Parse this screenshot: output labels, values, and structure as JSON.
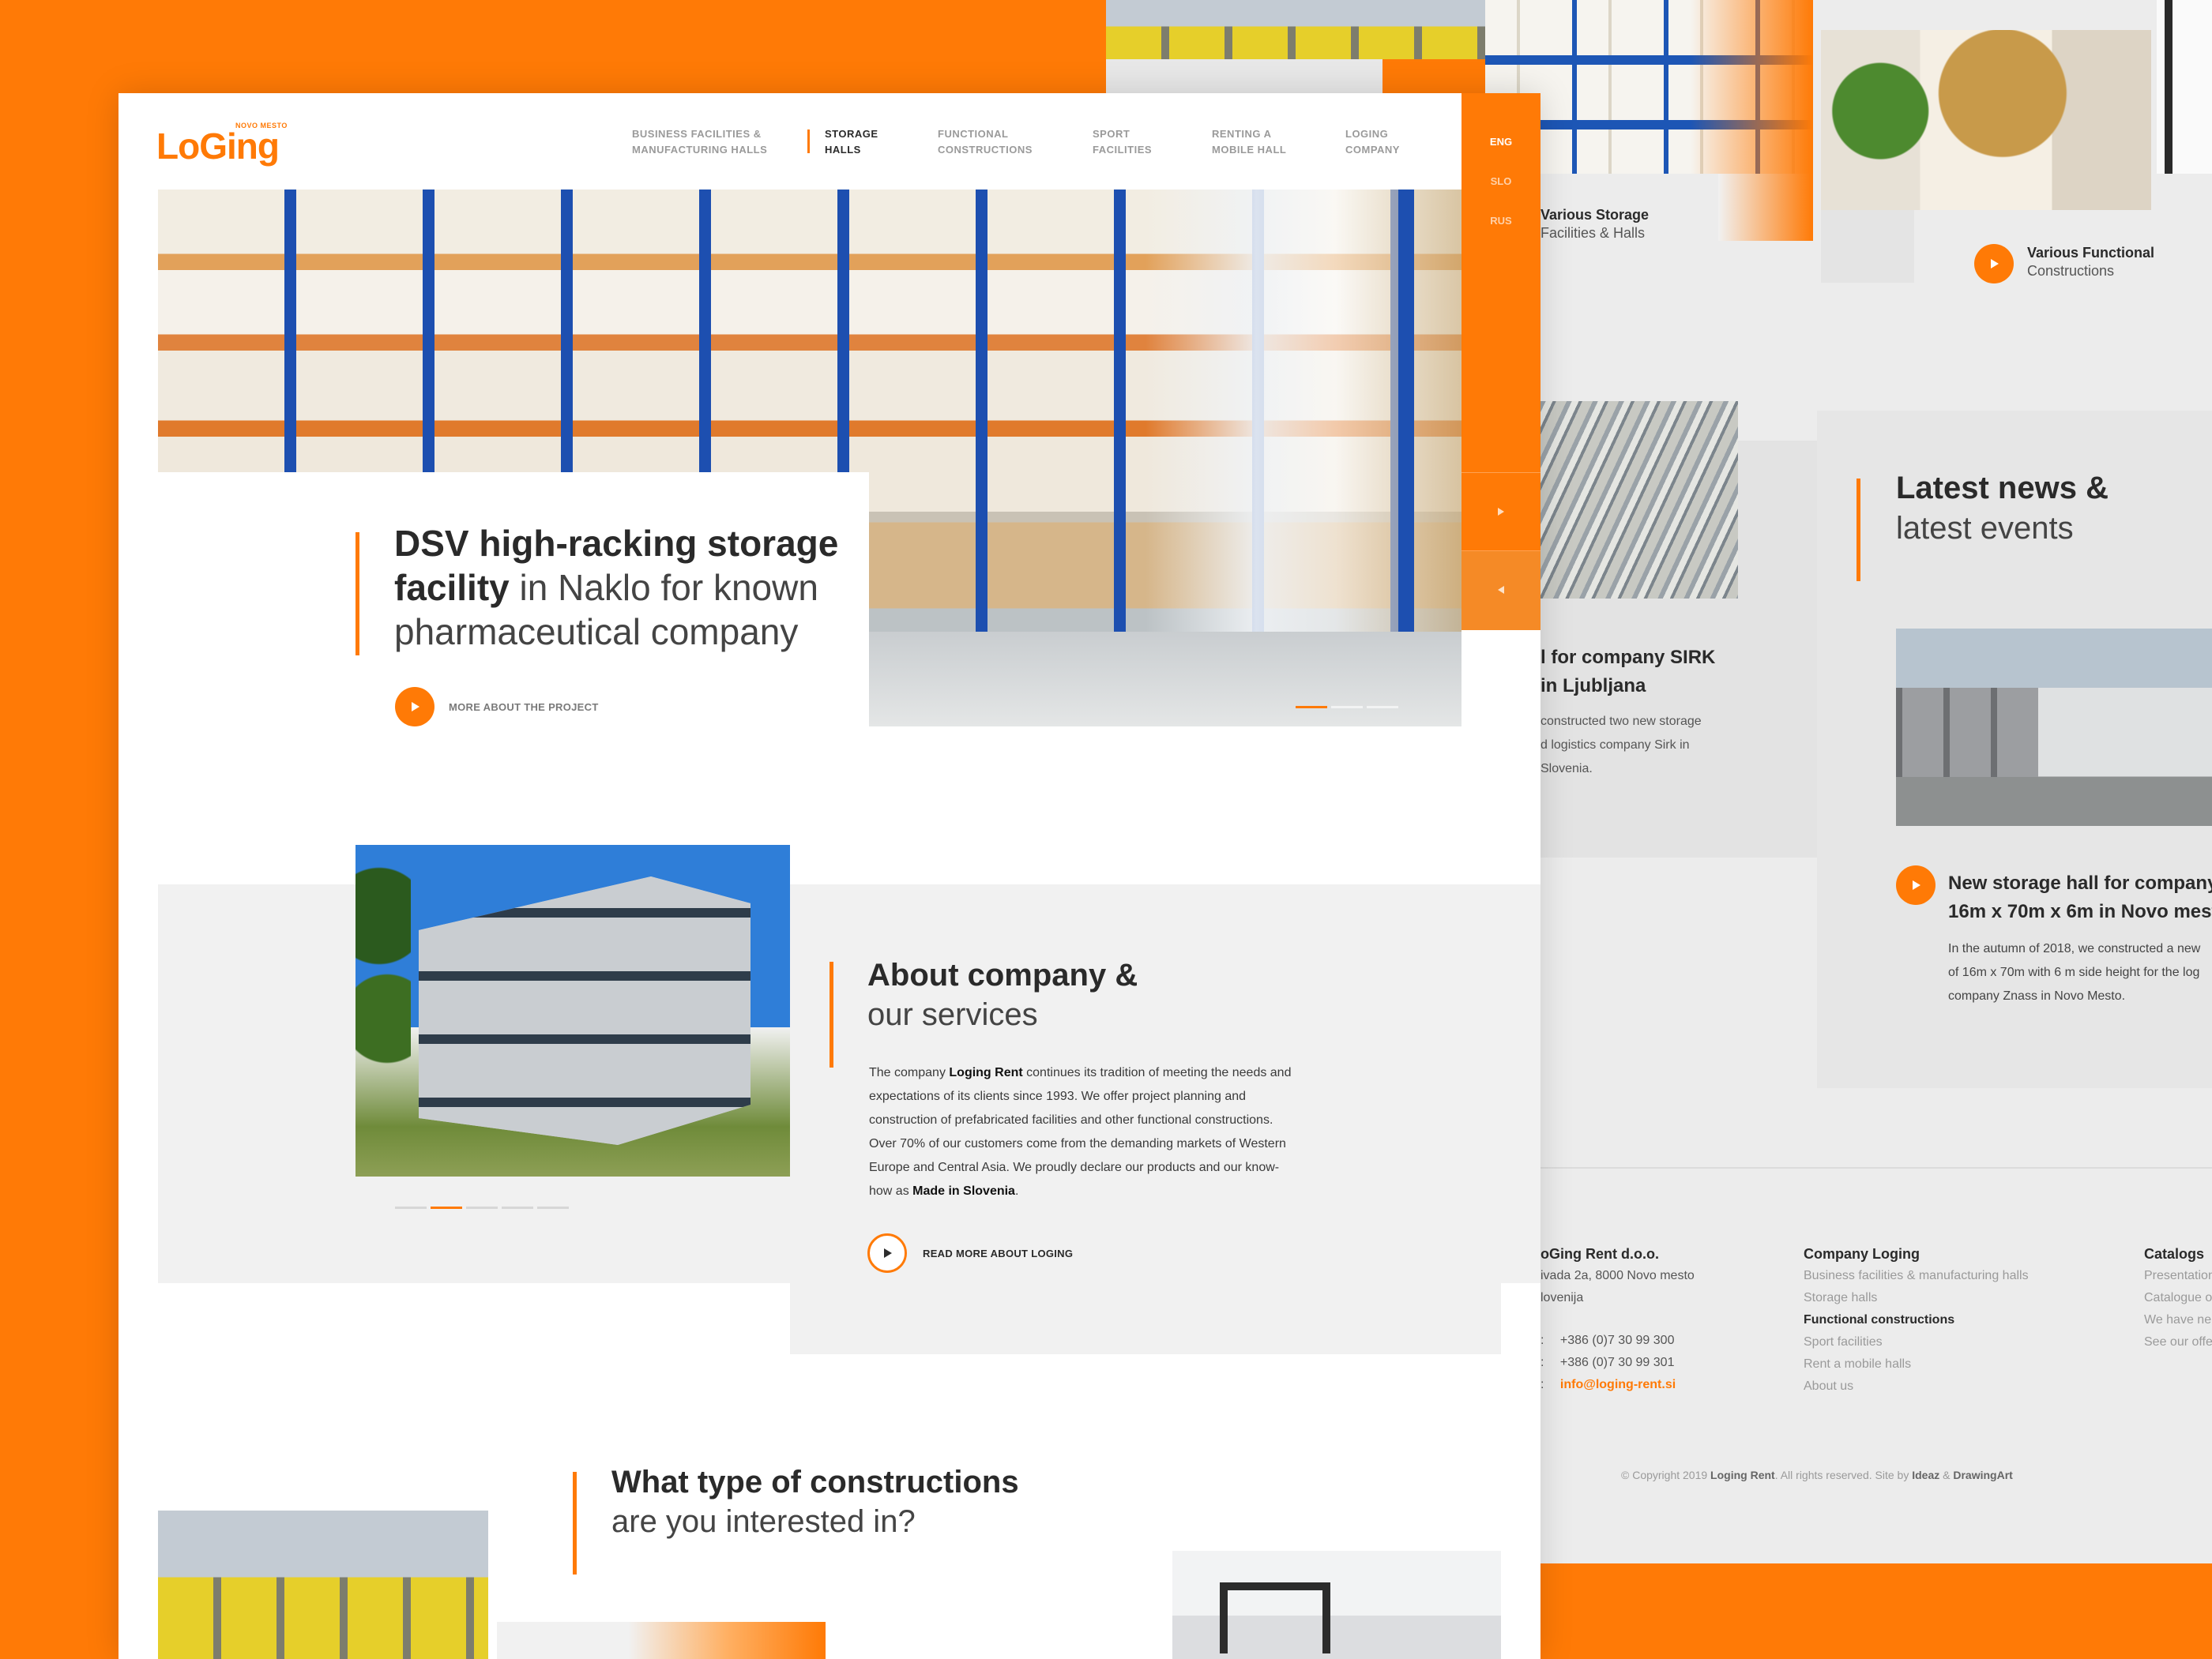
{
  "front": {
    "logo": {
      "main": "LoGing",
      "sub": "NOVO MESTO"
    },
    "nav": [
      {
        "line1": "BUSINESS FACILITIES &",
        "line2": "MANUFACTURING HALLS"
      },
      {
        "line1": "STORAGE",
        "line2": "HALLS"
      },
      {
        "line1": "FUNCTIONAL",
        "line2": "CONSTRUCTIONS"
      },
      {
        "line1": "SPORT",
        "line2": "FACILITIES"
      },
      {
        "line1": "RENTING A",
        "line2": "MOBILE HALL"
      },
      {
        "line1": "LOGING",
        "line2": "COMPANY"
      }
    ],
    "languages": [
      "ENG",
      "SLO",
      "RUS"
    ],
    "hero": {
      "title_bold_1": "DSV high-racking storage",
      "title_bold_2": "facility",
      "title_light_2": " in Naklo for known",
      "title_light_3": "pharmaceutical company",
      "cta": "MORE ABOUT THE PROJECT"
    },
    "about": {
      "title_bold": "About company &",
      "title_light": "our services",
      "p1": "The company ",
      "p_brand": "Loging Rent",
      "p2": " continues its tradition of meeting the needs and expectations of its clients since 1993. We offer project planning and construction of prefabricated facilities and other functional constructions. Over 70% of our customers come from the demanding markets of Western Europe and Central Asia. We proudly declare our products and our know-how as ",
      "p_bold": "Made in Slovenia",
      "p3": ".",
      "cta": "READ MORE ABOUT LOGING"
    },
    "types": {
      "title_bold": "What type of constructions",
      "title_light": "are you interested in?"
    }
  },
  "back": {
    "cards": [
      {
        "line1": "Various Storage",
        "line2": "Facilities & Halls"
      },
      {
        "line1": "Various Functional",
        "line2": "Constructions"
      }
    ],
    "news": {
      "title_bold": "Latest news &",
      "title_light": "latest events",
      "item1": {
        "title1": "l for company SIRK",
        "title2": "in Ljubljana",
        "text": [
          "constructed two new storage",
          "d logistics company Sirk in",
          "Slovenia."
        ]
      },
      "item2": {
        "title1": "New storage hall for company",
        "title2": "16m x 70m x 6m in Novo mest",
        "text": [
          "In the autumn of 2018, we constructed a new",
          "of 16m x 70m with 6 m side height for the log",
          "company Znass in Novo Mesto."
        ]
      }
    },
    "footer": {
      "col1": {
        "title": "oGing Rent d.o.o.",
        "lines": [
          "ivada 2a, 8000 Novo mesto",
          "lovenija"
        ],
        "phone1": "+386 (0)7 30 99 300",
        "phone2": "+386 (0)7 30 99 301",
        "email": "info@loging-rent.si",
        "prefix": ":"
      },
      "col2": {
        "title": "Company Loging",
        "items": [
          "Business facilities & manufacturing halls",
          "Storage halls",
          "Functional constructions",
          "Sport facilities",
          "Rent a mobile halls",
          "About us"
        ]
      },
      "col3": {
        "title": "Catalogs",
        "items": [
          "Presentation",
          "Catalogue o",
          "We have ne",
          "See our offe"
        ]
      },
      "copyright_1": "© Copyright 2019 ",
      "copyright_brand": "Loging Rent",
      "copyright_2": ". All rights reserved. Site by ",
      "copyright_ideaz": "Ideaz",
      "copyright_amp": " & ",
      "copyright_da": "DrawingArt"
    }
  }
}
